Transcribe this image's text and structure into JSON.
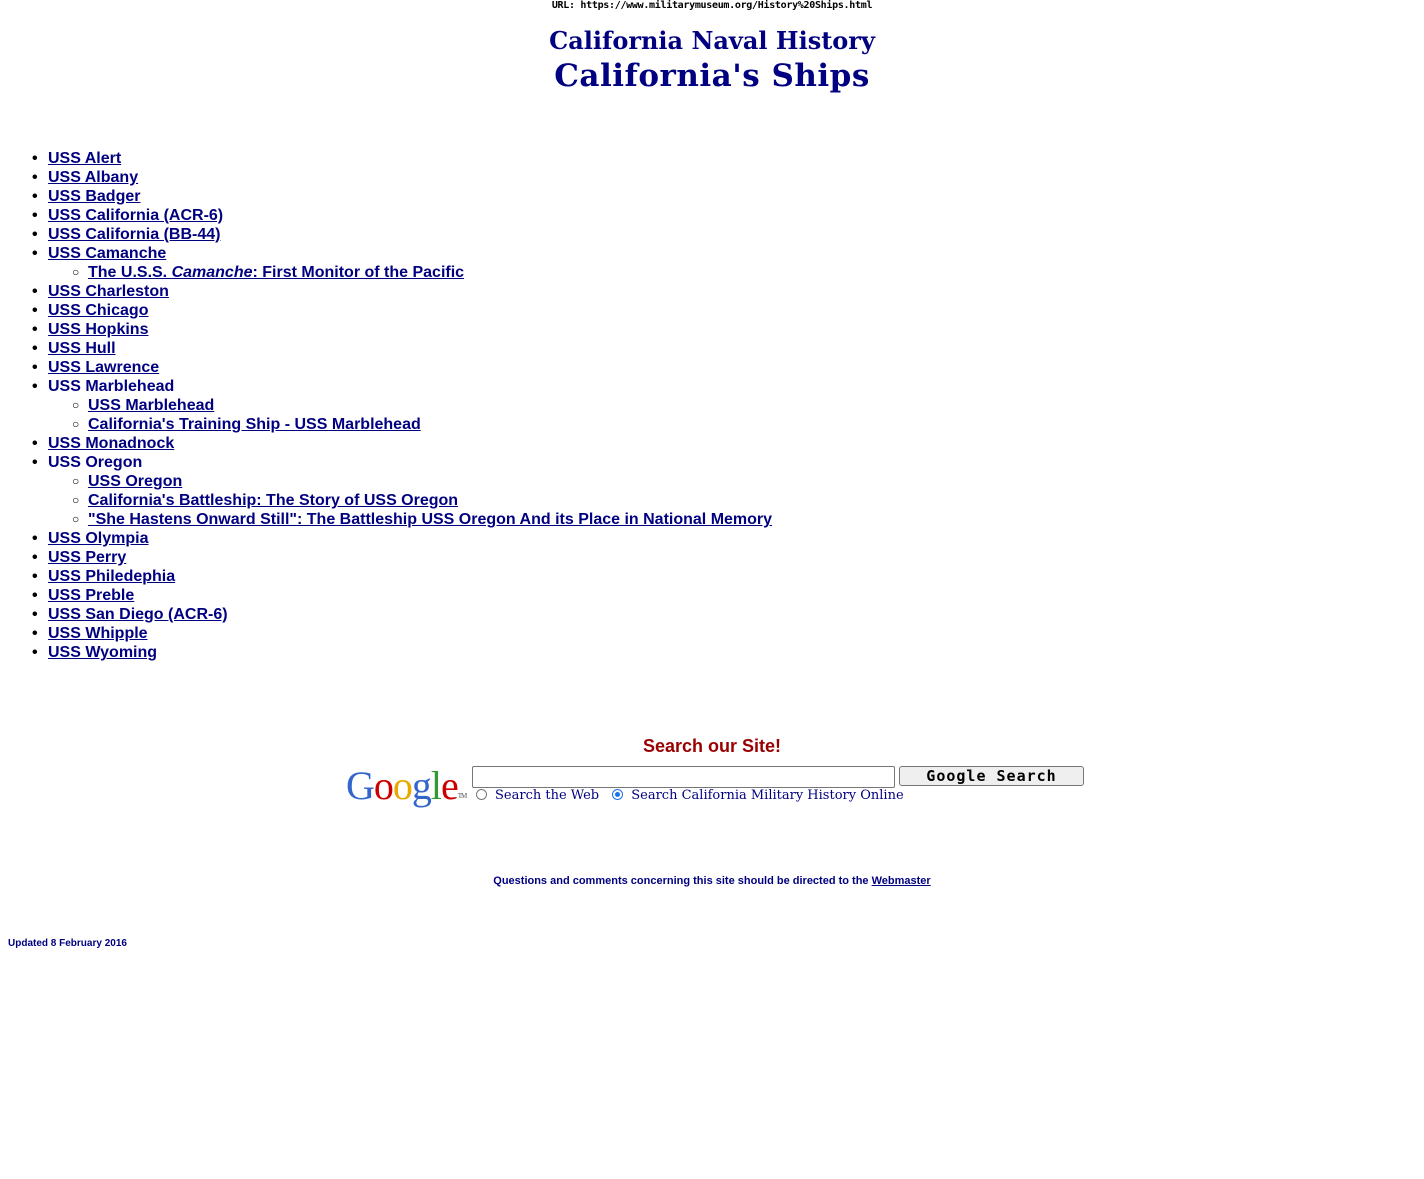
{
  "header": {
    "url_line": "URL: https://www.militarymuseum.org/History%20Ships.html",
    "site_title": "California Naval History",
    "page_title": "California's Ships"
  },
  "ships": [
    {
      "label": "USS Alert",
      "link": true
    },
    {
      "label": "USS Albany",
      "link": true
    },
    {
      "label": "USS Badger",
      "link": true
    },
    {
      "label": "USS California (ACR-6)",
      "link": true
    },
    {
      "label": "USS California (BB-44)",
      "link": true
    },
    {
      "label": "USS Camanche",
      "link": true
    },
    {
      "sub": {
        "prefix": "The U.S.S. ",
        "italic": "Camanche",
        "suffix": ": First Monitor of the Pacific"
      }
    },
    {
      "label": "USS Charleston",
      "link": true
    },
    {
      "label": "USS Chicago",
      "link": true
    },
    {
      "label": "USS Hopkins",
      "link": true
    },
    {
      "label": "USS Hull",
      "link": true
    },
    {
      "label": "USS Lawrence",
      "link": true
    },
    {
      "label": "USS Marblehead",
      "link": false
    },
    {
      "sub": {
        "label": "USS Marblehead"
      }
    },
    {
      "sub": {
        "label": "California's Training Ship - USS Marblehead"
      }
    },
    {
      "label": "USS Monadnock",
      "link": true
    },
    {
      "label": "USS Oregon",
      "link": false
    },
    {
      "sub": {
        "label": "USS Oregon"
      }
    },
    {
      "sub": {
        "label": "California's Battleship: The Story of USS Oregon"
      }
    },
    {
      "sub": {
        "label": "\"She Hastens Onward Still\": The Battleship USS Oregon And its Place in National Memory"
      }
    },
    {
      "label": "USS Olympia",
      "link": true
    },
    {
      "label": "USS Perry",
      "link": true
    },
    {
      "label": "USS Philedephia",
      "link": true
    },
    {
      "label": "USS Preble",
      "link": true
    },
    {
      "label": "USS San Diego (ACR-6)",
      "link": true
    },
    {
      "label": "USS Whipple",
      "link": true
    },
    {
      "label": "USS Wyoming",
      "link": true
    }
  ],
  "search": {
    "heading": "Search our Site!",
    "logo_letters": [
      "G",
      "o",
      "o",
      "g",
      "l",
      "e"
    ],
    "logo_colors": [
      "#3366cc",
      "#cc0000",
      "#e8a800",
      "#3366cc",
      "#339933",
      "#cc0000"
    ],
    "logo_tm": "TM",
    "input_value": "",
    "button_label": "Google Search",
    "options": [
      {
        "label": "Search the Web",
        "checked": false
      },
      {
        "label": "Search California Military History Online",
        "checked": true
      }
    ]
  },
  "footer": {
    "contact_text": "Questions and comments concerning this site should be directed to the ",
    "webmaster_label": "Webmaster",
    "updated": "Updated 8 February 2016"
  }
}
